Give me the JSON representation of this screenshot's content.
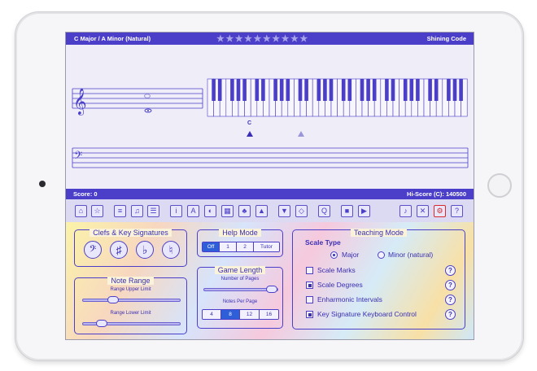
{
  "header": {
    "key_label": "C Major",
    "separator": "/",
    "minor_label": "A Minor (Natural)",
    "brand": "Shining Code",
    "stars_total": 10
  },
  "staff": {
    "note_label": "C"
  },
  "score": {
    "score_label": "Score: 0",
    "hiscore_label": "Hi-Score (C): 140500"
  },
  "toolbar": {
    "icons": [
      "home-icon",
      "star-icon",
      "lesson-icon",
      "piano-keys-icon",
      "list-icon",
      "info-icon",
      "font-icon",
      "palette-icon",
      "grid-icon",
      "tree-icon",
      "landscape-icon",
      "guitar-pick-icon",
      "sharp-shape-icon",
      "q-icon",
      "stop-icon",
      "play-icon",
      "speaker-on-icon",
      "speaker-off-icon",
      "gear-icon",
      "help-icon"
    ],
    "info_glyph": "i",
    "font_glyph": "A",
    "help_glyph": "?"
  },
  "clefs": {
    "title": "Clefs & Key Signatures",
    "glyphs": [
      "𝄢",
      "♯",
      "♭",
      "♮"
    ]
  },
  "note_range": {
    "title": "Note Range",
    "upper_label": "Range Upper Limit",
    "lower_label": "Range Lower Limit"
  },
  "help_mode": {
    "title": "Help Mode",
    "options": [
      "Off",
      "1",
      "2",
      "Tutor"
    ],
    "selected": "Off"
  },
  "game_length": {
    "title": "Game Length",
    "pages_label": "Number of Pages",
    "notes_label": "Notes Per Page",
    "notes_options": [
      "4",
      "8",
      "12",
      "16"
    ],
    "notes_selected": "8"
  },
  "teaching_mode": {
    "title": "Teaching Mode",
    "scale_type_label": "Scale Type",
    "major_label": "Major",
    "minor_label": "Minor (natural)",
    "selected_scale": "Major",
    "options": [
      {
        "label": "Scale Marks",
        "checked": false
      },
      {
        "label": "Scale Degrees",
        "checked": true
      },
      {
        "label": "Enharmonic Intervals",
        "checked": false
      },
      {
        "label": "Key Signature Keyboard Control",
        "checked": true
      }
    ]
  },
  "colors": {
    "accent": "#4b3fc9",
    "toolbar_bg": "#dcd9f3",
    "staff_bg": "#eeedf8"
  }
}
